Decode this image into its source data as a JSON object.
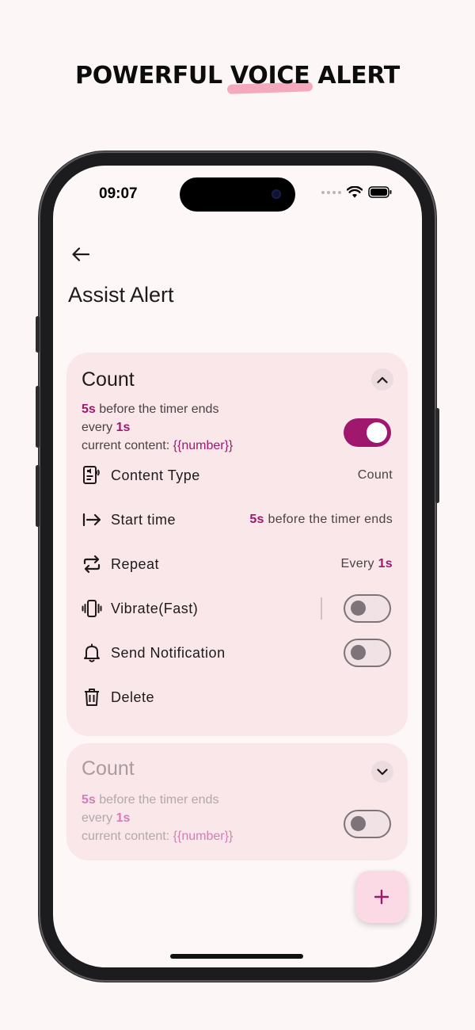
{
  "headline": {
    "part1": "POWERFUL ",
    "highlight": "VOICE",
    "part2": " ALERT"
  },
  "status_bar": {
    "time": "09:07"
  },
  "page": {
    "title": "Assist Alert"
  },
  "alerts": [
    {
      "title": "Count",
      "summary": {
        "lead": "5s",
        "lead_suffix": " before the timer ends",
        "repeat_prefix": "every ",
        "repeat_value": "1s",
        "content_prefix": "current content: ",
        "content_value": "{{number}}"
      },
      "enabled": true,
      "expanded": true,
      "settings": {
        "content_type": {
          "label": "Content Type",
          "value": "Count"
        },
        "start_time": {
          "label": "Start time",
          "value_strong": "5s",
          "value_rest": " before the timer ends"
        },
        "repeat": {
          "label": "Repeat",
          "value_prefix": "Every ",
          "value_strong": "1s"
        },
        "vibrate": {
          "label": "Vibrate(Fast)",
          "enabled": false
        },
        "notification": {
          "label": "Send Notification",
          "enabled": false
        },
        "delete": {
          "label": "Delete"
        }
      }
    },
    {
      "title": "Count",
      "summary": {
        "lead": "5s",
        "lead_suffix": " before the timer ends",
        "repeat_prefix": "every ",
        "repeat_value": "1s",
        "content_prefix": "current content: ",
        "content_value": "{{number}}"
      },
      "enabled": false,
      "expanded": false
    }
  ],
  "icons": [
    "back-arrow-icon",
    "chevron-up-icon",
    "chevron-down-icon",
    "content-type-icon",
    "start-time-icon",
    "repeat-icon",
    "vibrate-icon",
    "bell-icon",
    "trash-icon",
    "plus-icon",
    "wifi-icon",
    "battery-icon",
    "signal-icon"
  ],
  "colors": {
    "accent": "#a0186e",
    "card_bg": "#f9e7ea",
    "screen_bg": "#fdf7f7",
    "fab_bg": "#fbd9e5",
    "highlight": "#f4a9bd"
  }
}
